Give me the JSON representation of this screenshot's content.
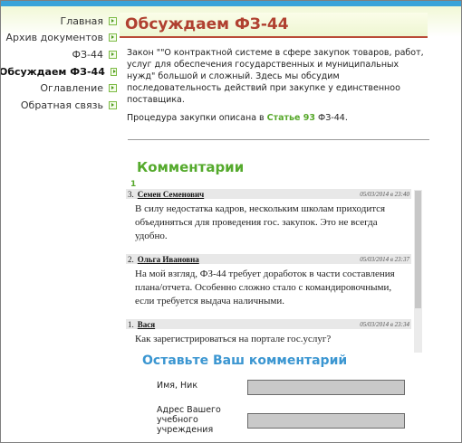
{
  "nav": {
    "items": [
      {
        "label": "Главная"
      },
      {
        "label": "Архив документов"
      },
      {
        "label": "ФЗ-44"
      },
      {
        "label": "Обсуждаем ФЗ-44"
      },
      {
        "label": "Оглавление"
      },
      {
        "label": "Обратная связь"
      }
    ]
  },
  "page": {
    "title": "Обсуждаем ФЗ-44",
    "intro": "Закон \"\"О контрактной системе в сфере закупок товаров, работ, услуг для обеспечения государственных и муниципальных нужд\" большой и сложный. Здесь мы обсудим последовательность действий  при закупке у единственноо поставщика.",
    "procedure_prefix": "Процедура закупки описана в ",
    "procedure_link": "Статье 93",
    "procedure_suffix": " ФЗ-44."
  },
  "comments": {
    "heading": "Комментарии",
    "pager": "1",
    "items": [
      {
        "num": "3.",
        "author": "Семен Семенович",
        "date": "05/03/2014 в 23:40",
        "text": "В силу недостатка кадров, нескольким школам приходится объединяться для проведения гос. закупок. Это не всегда удобно."
      },
      {
        "num": "2.",
        "author": "Ольга Ивановна",
        "date": "05/03/2014 в 23:37",
        "text": "На мой взгляд, ФЗ-44 требует доработок в части составления плана/отчета. Особенно сложно стало с командировочными, если требуется выдача наличными."
      },
      {
        "num": "1.",
        "author": "Вася",
        "date": "05/03/2014 в 23:34",
        "text": "Как зарегистрироваться на портале гос.услуг?"
      }
    ]
  },
  "form": {
    "heading": "Оставьте Ваш комментарий",
    "name_label": "Имя, Ник",
    "org_label": "Адрес Вашего учебного учреждения"
  },
  "colors": {
    "accent_green": "#57a82b",
    "title_red": "#b04030",
    "form_blue": "#3b96d1",
    "top_bar": "#39a3d9"
  }
}
